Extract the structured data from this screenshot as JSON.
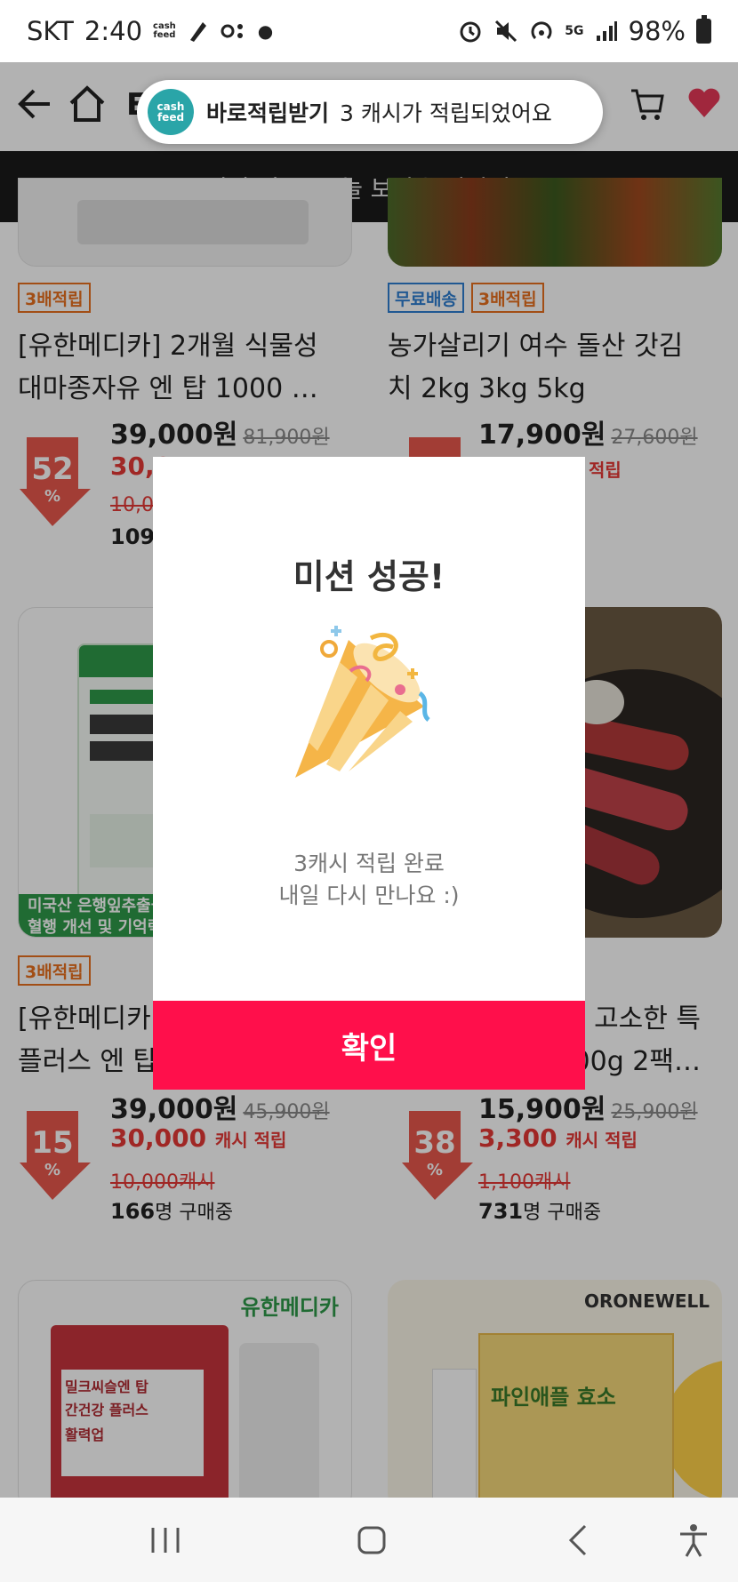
{
  "status_bar": {
    "carrier": "SKT",
    "time": "2:40",
    "app_badge": "cash\nfeed",
    "network": "5G",
    "battery": "98%"
  },
  "toast": {
    "logo_text": "cash\nfeed",
    "title": "바로적립받기",
    "message": "3 캐시가 적립되었어요"
  },
  "banner": {
    "text": "미션 성공! 오늘 보상을 받았어요"
  },
  "products": [
    {
      "tags": [
        "3배적립"
      ],
      "title_lines": [
        "[유한메디카] 2개월 식물성",
        "대마종자유 엔 탑 1000 …"
      ],
      "price": "39,000원",
      "original_price": "81,900원",
      "discount": "52",
      "cash": "30,0"
    },
    {
      "tags": [
        "무료배송",
        "3배적립"
      ],
      "title_lines": [
        "농가살리기 여수 돌산 갓김",
        "치 2kg 3kg 5kg"
      ],
      "price": "17,900원",
      "original_price": "27,600원",
      "cash_sub": "적립"
    },
    {
      "tags": [
        "3배적립"
      ],
      "title_lines": [
        "[유한메디카",
        "플러스 엔 탑"
      ],
      "price": "39,000원",
      "original_price": "45,900원",
      "discount": "15",
      "cash": "30,000",
      "cash_sub": "캐시 적립",
      "old_cash": "10,000",
      "old_cash_unit": "캐시",
      "buyers_count": "166",
      "buyers_suffix": "명 구매중",
      "thumb_caption": [
        "미국산 은행잎추출물",
        "혈행 개선 및 기억력"
      ]
    },
    {
      "title_lines": [
        "고소한 특",
        "00g 2팩…"
      ],
      "price": "15,900원",
      "original_price": "25,900원",
      "discount": "38",
      "cash": "3,300",
      "cash_sub": "캐시 적립",
      "old_cash": "1,100",
      "old_cash_unit": "캐시",
      "buyers_count": "731",
      "buyers_suffix": "명 구매중"
    }
  ],
  "partial_first_row": {
    "old_cash_left": "10,0",
    "buyers_left": "109"
  },
  "bottom_brands": {
    "left": "유한메디카",
    "right": "ORONEWELL",
    "right_product": "파인애플 효소",
    "left_product": [
      "밀크씨슬엔 탑",
      "간건강 플러스",
      "활력업"
    ]
  },
  "modal": {
    "title": "미션 성공!",
    "line1": "3캐시 적립 완료",
    "line2": "내일 다시 만나요 :)",
    "confirm": "확인"
  },
  "colors": {
    "accent": "#ff0f4b",
    "discount_red": "#e9584c",
    "tag_orange": "#e8701f",
    "tag_blue": "#2f7fd1",
    "cashfeed_teal": "#2aa5a8"
  }
}
